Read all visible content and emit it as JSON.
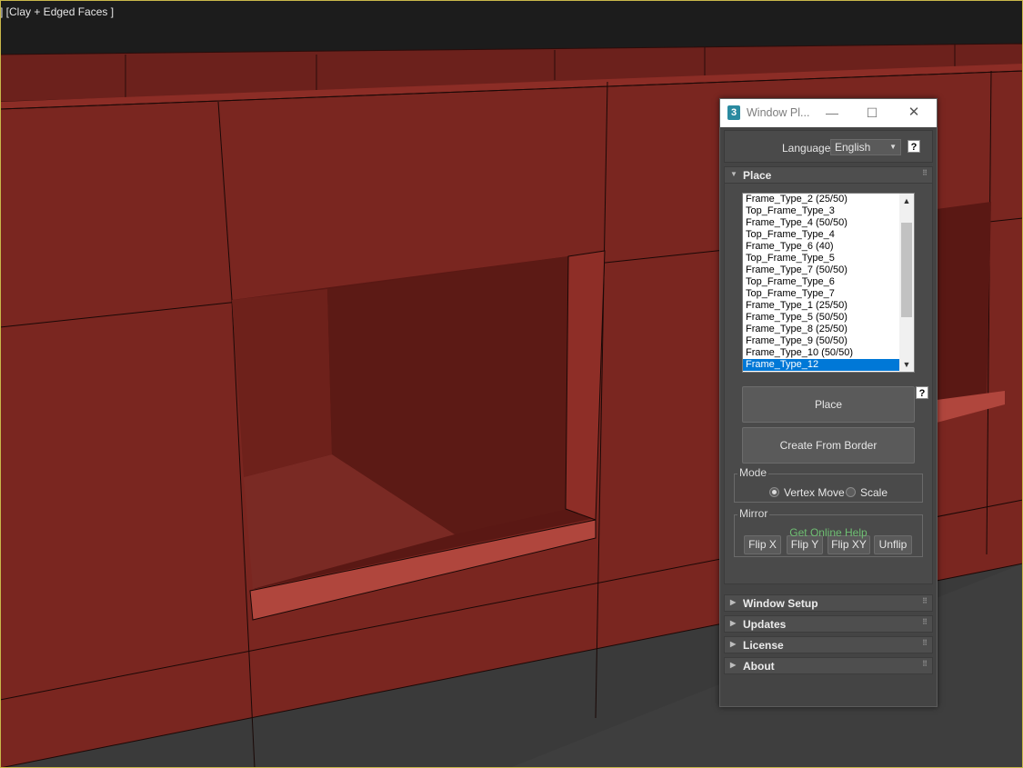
{
  "viewport": {
    "label": "] [Clay + Edged Faces ]"
  },
  "window": {
    "title": "Window Pl...",
    "app_icon_glyph": "3",
    "minimize_glyph": "—",
    "maximize_glyph": "☐",
    "close_glyph": "✕"
  },
  "language": {
    "label": "Language:",
    "selected": "English",
    "help": "?"
  },
  "place_rollout": {
    "title": "Place",
    "list_items": [
      "Frame_Type_2 (25/50)",
      "Top_Frame_Type_3",
      "Frame_Type_4 (50/50)",
      "Top_Frame_Type_4",
      "Frame_Type_6 (40)",
      "Top_Frame_Type_5",
      "Frame_Type_7 (50/50)",
      "Top_Frame_Type_6",
      "Top_Frame_Type_7",
      "Frame_Type_1 (25/50)",
      "Frame_Type_5 (50/50)",
      "Frame_Type_8 (25/50)",
      "Frame_Type_9 (50/50)",
      "Frame_Type_10 (50/50)",
      "Frame_Type_12"
    ],
    "selected_index": 14,
    "help": "?",
    "place_button": "Place",
    "create_button": "Create From Border",
    "mode": {
      "title": "Mode",
      "vertex_move": "Vertex Move",
      "scale": "Scale",
      "selected": "vertex_move"
    },
    "mirror": {
      "title": "Mirror",
      "flip_x": "Flip X",
      "flip_y": "Flip Y",
      "flip_xy": "Flip XY",
      "unflip": "Unflip"
    },
    "help_link": "Get Online Help"
  },
  "rollouts": [
    {
      "title": "Window Setup"
    },
    {
      "title": "Updates"
    },
    {
      "title": "License"
    },
    {
      "title": "About"
    }
  ],
  "colors": {
    "accent_selection": "#0078d7",
    "link": "#6fbf73",
    "wall_red": "#7a2620"
  }
}
